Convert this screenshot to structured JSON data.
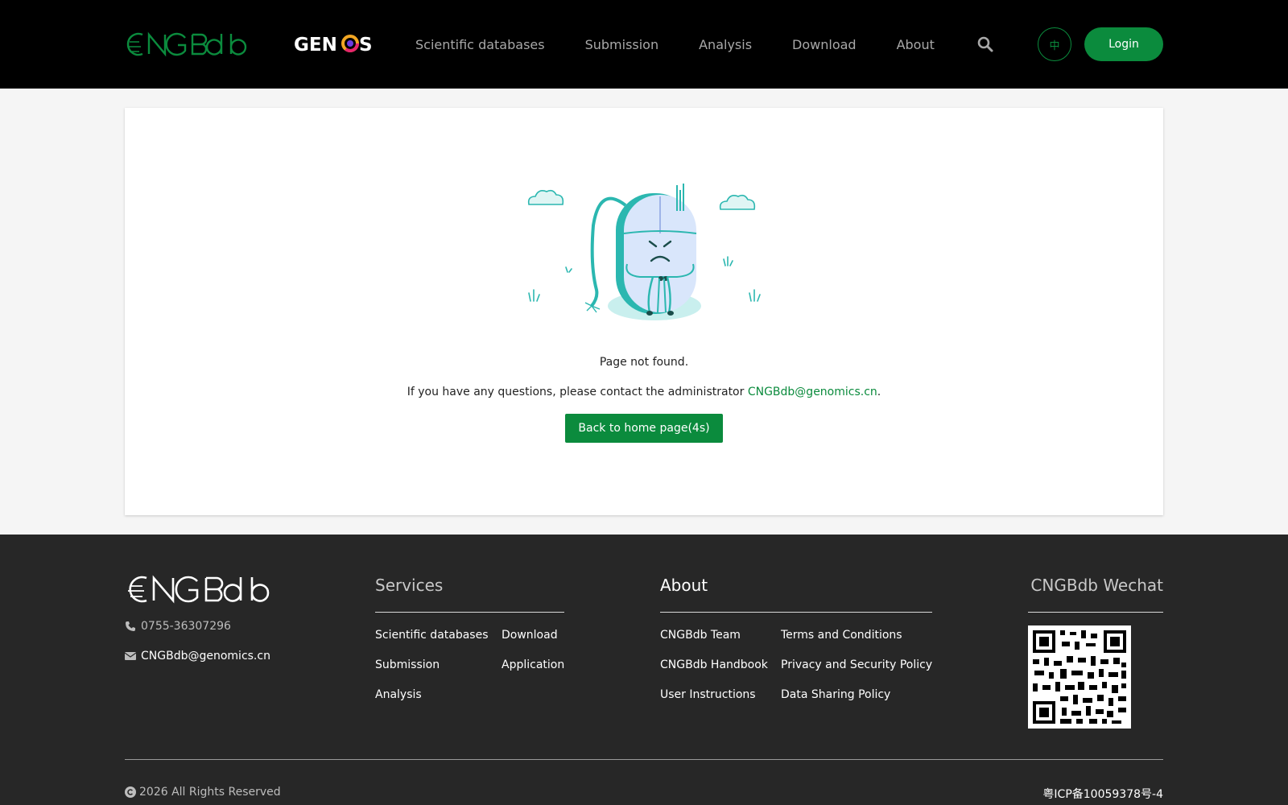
{
  "header": {
    "logo_text": "CNGBdb",
    "genos_text": "GENOS",
    "nav": [
      "Scientific databases",
      "Submission",
      "Analysis",
      "Download",
      "About"
    ],
    "lang_label": "中",
    "login_label": "Login",
    "search_icon": "search-icon"
  },
  "main": {
    "message": "Page not found.",
    "contact_prefix": "If you have any questions, please contact the administrator ",
    "contact_email": "CNGBdb@genomics.cn",
    "contact_suffix": ".",
    "back_button": "Back to home page(4s)",
    "illustration": "sad-mouse-illustration"
  },
  "footer": {
    "logo_text": "CNGBdb",
    "phone": "0755-36307296",
    "email": "CNGBdb@genomics.cn",
    "services_title": "Services",
    "services_links": [
      "Scientific databases",
      "Download",
      "Submission",
      "Application",
      "Analysis"
    ],
    "about_title": "About",
    "about_links": [
      "CNGBdb Team",
      "Terms and Conditions",
      "CNGBdb Handbook",
      "Privacy and Security Policy",
      "User Instructions",
      "Data Sharing Policy"
    ],
    "wechat_title": "CNGBdb Wechat",
    "copyright": "2026 All Rights Reserved",
    "icp": "粤ICP备10059378号-4"
  },
  "colors": {
    "brand_green": "#0b8b3d",
    "header_bg": "#000000",
    "footer_bg": "#272727",
    "illustration_teal": "#2bb7b0"
  }
}
